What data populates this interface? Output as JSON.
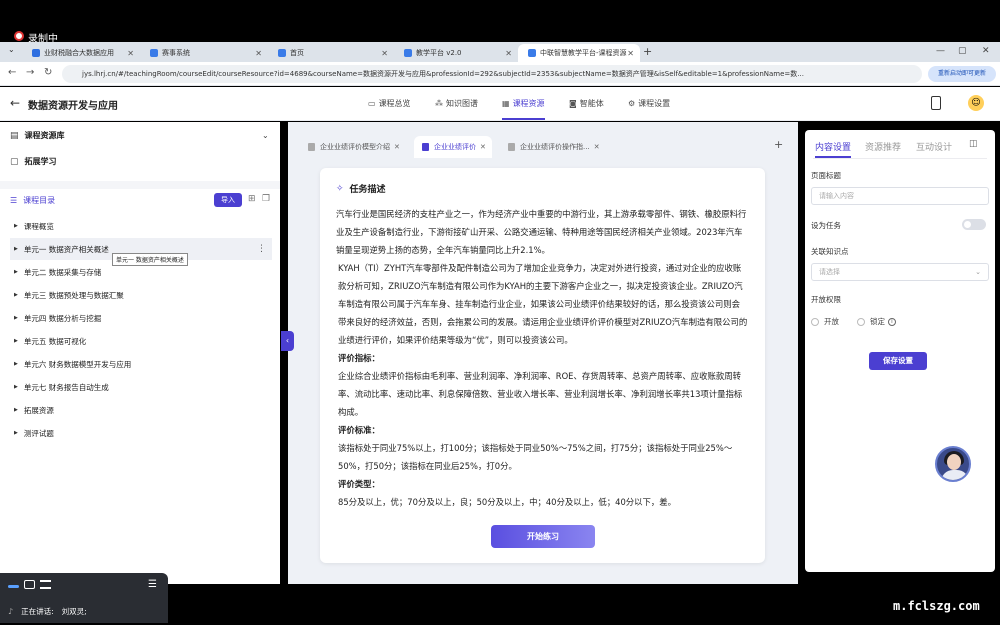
{
  "recording": {
    "label": "录制中"
  },
  "browser": {
    "tabs": [
      {
        "title": "业财税融合大数据应用",
        "color": "#2f6fe0"
      },
      {
        "title": "赛事系统",
        "color": "#3a7be8"
      },
      {
        "title": "首页",
        "color": "#3a7be8"
      },
      {
        "title": "教学平台 v2.0",
        "color": "#3a7be8"
      },
      {
        "title": "中联智慧教学平台-课程资源",
        "color": "#3a7be8"
      }
    ],
    "url": "jys.lhrj.cn/#/teachingRoom/courseEdit/courseResource?id=4689&courseName=数据资源开发与应用&professionId=292&subjectId=2353&subjectName=数据资产管理&isSelf&editable=1&professionName=数...",
    "update_label": "重新启动即可更新"
  },
  "app": {
    "title": "数据资源开发与应用",
    "nav": [
      {
        "label": "课程总览",
        "icon": "▭"
      },
      {
        "label": "知识图谱",
        "icon": "⁂"
      },
      {
        "label": "课程资源",
        "icon": "▦"
      },
      {
        "label": "智能体",
        "icon": "◙"
      },
      {
        "label": "课程设置",
        "icon": "⚙"
      }
    ]
  },
  "sidebar": {
    "library": "课程资源库",
    "extend": "拓展学习",
    "toc_title": "课程目录",
    "import_label": "导入",
    "items": [
      "课程概览",
      "单元一 数据资产相关概述",
      "单元二 数据采集与存储",
      "单元三 数据预处理与数据汇聚",
      "单元四 数据分析与挖掘",
      "单元五 数据可视化",
      "单元六 财务数据模型开发与应用",
      "单元七 财务报告自动生成",
      "拓展资源",
      "测评试题"
    ],
    "tooltip": "单元一 数据资产相关概述"
  },
  "content_tabs": [
    {
      "label": "企业业绩评价模型介绍"
    },
    {
      "label": "企业业绩评价"
    },
    {
      "label": "企业业绩评价操作指..."
    }
  ],
  "task": {
    "header": "任务描述",
    "p1": "汽车行业是国民经济的支柱产业之一，作为经济产业中重要的中游行业，其上游承载零部件、钢铁、橡胶原料行业及生产设备制造行业，下游衔接矿山开采、公路交通运输、特种用途等国民经济相关产业领域。2023年汽车销量呈现逆势上扬的态势，全年汽车销量同比上升2.1%。",
    "p2": "KYAH（TI）ZYHT汽车零部件及配件制造公司为了增加企业竞争力，决定对外进行投资，通过对企业的应收账款分析可知，ZRIUZO汽车制造有限公司作为KYAH的主要下游客户企业之一，拟决定投资该企业。ZRIUZO汽车制造有限公司属于汽车车身、挂车制造行业企业，如果该公司业绩评价结果较好的话，那么投资该公司则会带来良好的经济效益，否则，会拖累公司的发展。请运用企业业绩评价评价模型对ZRIUZO汽车制造有限公司的业绩进行评价，如果评价结果等级为“优”，则可以投资该公司。",
    "h_index": "评价指标：",
    "p_index": "企业综合业绩评价指标由毛利率、营业利润率、净利润率、ROE、存货周转率、总资产周转率、应收账款周转率、流动比率、速动比率、利息保障倍数、营业收入增长率、营业利润增长率、净利润增长率共13项计量指标构成。",
    "h_standard": "评价标准：",
    "p_standard": "该指标处于同业75%以上，打100分；该指标处于同业50%～75%之间，打75分；该指标处于同业25%～50%，打50分；该指标在同业后25%，打0分。",
    "h_type": "评价类型：",
    "p_type": "85分及以上，优；70分及以上，良；50分及以上，中；40分及以上，低；40分以下，差。",
    "start_label": "开始练习"
  },
  "right_panel": {
    "tabs": [
      "内容设置",
      "资源推荐",
      "互动设计"
    ],
    "page_title_label": "页面标题",
    "page_title_placeholder": "请输入内容",
    "task_label": "设为任务",
    "knowledge_label": "关联知识点",
    "knowledge_placeholder": "请选择",
    "permission_label": "开放权限",
    "opt_open": "开放",
    "opt_lock": "锁定",
    "save_label": "保存设置"
  },
  "meeting": {
    "speaking_label": "正在讲话:",
    "speaker": "刘双灵;"
  },
  "watermark": "m.fclszg.com",
  "colors": {
    "accent": "#4b3fd1"
  }
}
